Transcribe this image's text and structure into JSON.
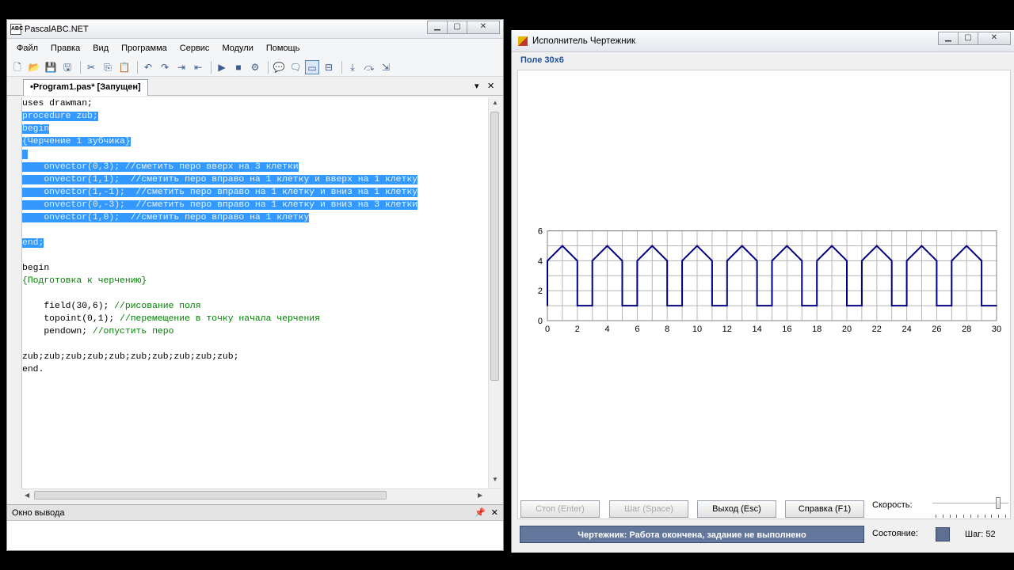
{
  "pabc": {
    "title": "PascalABC.NET",
    "menu": [
      "Файл",
      "Правка",
      "Вид",
      "Программа",
      "Сервис",
      "Модули",
      "Помощь"
    ],
    "tab_label": "•Program1.pas* [Запущен]",
    "code_lines": [
      {
        "code": "uses drawman;",
        "comment": "",
        "selected": false
      },
      {
        "code": "procedure zub;",
        "comment": "",
        "selected": true
      },
      {
        "code": "begin",
        "comment": "",
        "selected": true
      },
      {
        "code": "",
        "comment": "{Черчение 1 зубчика}",
        "selected": true
      },
      {
        "code": " ",
        "comment": "",
        "selected": true
      },
      {
        "code": "    onvector(0,3); ",
        "comment": "//сметить перо вверх на 3 клетки",
        "selected": true
      },
      {
        "code": "    onvector(1,1);  ",
        "comment": "//сметить перо вправо на 1 клетку и вверх на 1 клетку",
        "selected": true
      },
      {
        "code": "    onvector(1,-1);  ",
        "comment": "//сметить перо вправо на 1 клетку и вниз на 1 клетку",
        "selected": true
      },
      {
        "code": "    onvector(0,-3);  ",
        "comment": "//сметить перо вправо на 1 клетку и вниз на 3 клетки",
        "selected": true
      },
      {
        "code": "    onvector(1,0);  ",
        "comment": "//сметить перо вправо на 1 клетку",
        "selected": true
      },
      {
        "code": "",
        "comment": "",
        "selected": false
      },
      {
        "code": "end;",
        "comment": "",
        "selected": true
      },
      {
        "code": "",
        "comment": "",
        "selected": false
      },
      {
        "code": "begin",
        "comment": "",
        "selected": false
      },
      {
        "code": "",
        "comment": "{Подготовка к черчению}",
        "selected": false
      },
      {
        "code": "",
        "comment": "",
        "selected": false
      },
      {
        "code": "    field(30,6); ",
        "comment": "//рисование поля",
        "selected": false
      },
      {
        "code": "    topoint(0,1); ",
        "comment": "//перемещение в точку начала черчения",
        "selected": false
      },
      {
        "code": "    pendown; ",
        "comment": "//опустить перо",
        "selected": false
      },
      {
        "code": "",
        "comment": "",
        "selected": false
      },
      {
        "code": "zub;zub;zub;zub;zub;zub;zub;zub;zub;zub;",
        "comment": "",
        "selected": false
      },
      {
        "code": "end.",
        "comment": "",
        "selected": false
      }
    ],
    "output_title": "Окно вывода",
    "pin_icon": "pin-icon"
  },
  "drawer": {
    "title": "Исполнитель Чертежник",
    "field_label": "Поле 30x6",
    "buttons": {
      "stop": "Стоп (Enter)",
      "step": "Шаг (Space)",
      "exit": "Выход (Esc)",
      "help": "Справка (F1)"
    },
    "status_text": "Чертежник: Работа окончена, задание не выполнено",
    "speed_label": "Скорость:",
    "state_label": "Состояние:",
    "step_label": "Шаг: 52",
    "speed_level": 0.9,
    "state_color": "#5e6f94"
  },
  "chart_data": {
    "type": "line",
    "xlim": [
      0,
      30
    ],
    "ylim": [
      0,
      6
    ],
    "x_ticks": [
      "0",
      "2",
      "4",
      "6",
      "8",
      "10",
      "12",
      "14",
      "16",
      "18",
      "20",
      "22",
      "24",
      "26",
      "28",
      "30"
    ],
    "y_ticks": [
      "0",
      "2",
      "4",
      "6"
    ],
    "grid": true,
    "series": [
      {
        "color": "#000080",
        "points": [
          [
            0,
            1
          ],
          [
            0,
            4
          ],
          [
            1,
            5
          ],
          [
            2,
            4
          ],
          [
            2,
            1
          ],
          [
            3,
            1
          ],
          [
            3,
            4
          ],
          [
            4,
            5
          ],
          [
            5,
            4
          ],
          [
            5,
            1
          ],
          [
            6,
            1
          ],
          [
            6,
            4
          ],
          [
            7,
            5
          ],
          [
            8,
            4
          ],
          [
            8,
            1
          ],
          [
            9,
            1
          ],
          [
            9,
            4
          ],
          [
            10,
            5
          ],
          [
            11,
            4
          ],
          [
            11,
            1
          ],
          [
            12,
            1
          ],
          [
            12,
            4
          ],
          [
            13,
            5
          ],
          [
            14,
            4
          ],
          [
            14,
            1
          ],
          [
            15,
            1
          ],
          [
            15,
            4
          ],
          [
            16,
            5
          ],
          [
            17,
            4
          ],
          [
            17,
            1
          ],
          [
            18,
            1
          ],
          [
            18,
            4
          ],
          [
            19,
            5
          ],
          [
            20,
            4
          ],
          [
            20,
            1
          ],
          [
            21,
            1
          ],
          [
            21,
            4
          ],
          [
            22,
            5
          ],
          [
            23,
            4
          ],
          [
            23,
            1
          ],
          [
            24,
            1
          ],
          [
            24,
            4
          ],
          [
            25,
            5
          ],
          [
            26,
            4
          ],
          [
            26,
            1
          ],
          [
            27,
            1
          ],
          [
            27,
            4
          ],
          [
            28,
            5
          ],
          [
            29,
            4
          ],
          [
            29,
            1
          ],
          [
            30,
            1
          ]
        ]
      }
    ]
  }
}
